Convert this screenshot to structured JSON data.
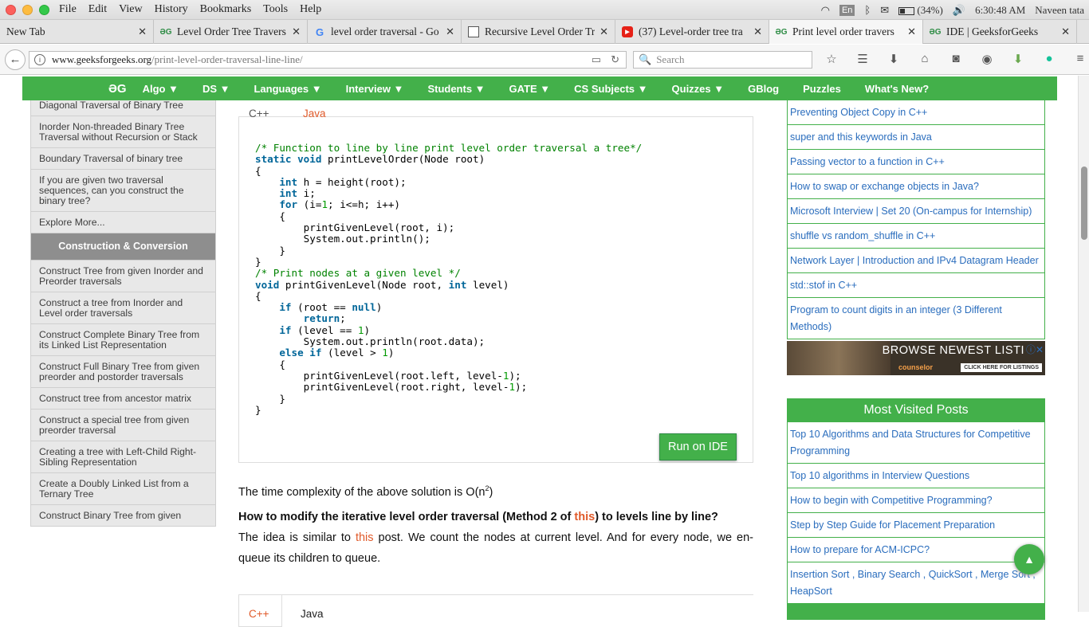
{
  "menubar": {
    "items": [
      "File",
      "Edit",
      "View",
      "History",
      "Bookmarks",
      "Tools",
      "Help"
    ],
    "battery": "(34%)",
    "lang": "En",
    "time": "6:30:48 AM",
    "user": "Naveen tata"
  },
  "tabs": [
    {
      "title": "New Tab",
      "icon": "none"
    },
    {
      "title": "Level Order Tree Travers",
      "icon": "gfg-icon"
    },
    {
      "title": "level order traversal - Go",
      "icon": "google-icon"
    },
    {
      "title": "Recursive Level Order Tr",
      "icon": "page-icon"
    },
    {
      "title": "(37) Level-order tree tra",
      "icon": "youtube-icon"
    },
    {
      "title": "Print level order travers",
      "icon": "gfg-icon",
      "active": true
    },
    {
      "title": "IDE | GeeksforGeeks",
      "icon": "gfg-icon"
    }
  ],
  "address": {
    "domain": "www.geeksforgeeks.org",
    "path": "/print-level-order-traversal-line-line/"
  },
  "search": {
    "placeholder": "Search"
  },
  "sitenav": {
    "logo": "ƏG",
    "items": [
      "Algo ▼",
      "DS ▼",
      "Languages ▼",
      "Interview ▼",
      "Students ▼",
      "GATE ▼",
      "CS Subjects ▼",
      "Quizzes ▼",
      "GBlog",
      "Puzzles",
      "What's New?"
    ]
  },
  "sidebar": [
    {
      "label": "Diagonal Traversal of Binary Tree"
    },
    {
      "label": "Inorder Non-threaded Binary Tree Traversal without Recursion or Stack"
    },
    {
      "label": "Boundary Traversal of binary tree"
    },
    {
      "label": "If you are given two traversal sequences, can you construct the binary tree?"
    },
    {
      "label": "Explore More..."
    },
    {
      "label": "Construction & Conversion",
      "header": true
    },
    {
      "label": "Construct Tree from given Inorder and Preorder traversals"
    },
    {
      "label": "Construct a tree from Inorder and Level order traversals"
    },
    {
      "label": "Construct Complete Binary Tree from its Linked List Representation"
    },
    {
      "label": "Construct Full Binary Tree from given preorder and postorder traversals"
    },
    {
      "label": "Construct tree from ancestor matrix"
    },
    {
      "label": "Construct a special tree from given preorder traversal"
    },
    {
      "label": "Creating a tree with Left-Child Right-Sibling Representation"
    },
    {
      "label": "Create a Doubly Linked List from a Ternary Tree"
    },
    {
      "label": "Construct Binary Tree from given"
    }
  ],
  "codetabs": {
    "cpp": "C++",
    "java": "Java"
  },
  "run_label": "Run on IDE",
  "complexity": {
    "text": "The time complexity of the above solution is O(n",
    "sup": "2",
    "close": ")"
  },
  "question": {
    "pre": "How to modify the iterative level order traversal (Method 2 of ",
    "link": "this",
    "post": ") to levels line by line?"
  },
  "idea": {
    "pre": "The idea is similar to ",
    "link": "this",
    "post": " post. We count the nodes at current level. And for every node, we en-queue its children to queue."
  },
  "right_links": [
    "Preventing Object Copy in C++",
    "super and this keywords in Java",
    "Passing vector to a function in C++",
    "How to swap or exchange objects in Java?",
    "Microsoft Interview | Set 20 (On-campus for Internship)",
    "shuffle vs random_shuffle in C++",
    "Network Layer | Introduction and IPv4 Datagram Header",
    "std::stof in C++",
    "Program to count digits in an integer (3 Different Methods)"
  ],
  "ad": {
    "text": "BROWSE NEWEST LISTI",
    "brand": "counselor",
    "cta": "CLICK HERE FOR LISTINGS"
  },
  "most_visited": {
    "title": "Most Visited Posts",
    "items": [
      "Top 10 Algorithms and Data Structures for Competitive Programming",
      "Top 10 algorithms in Interview Questions",
      "How to begin with Competitive Programming?",
      "Step by Step Guide for Placement Preparation",
      "How to prepare for ACM-ICPC?",
      "Insertion Sort , Binary Search , QuickSort , Merge Sort , HeapSort"
    ]
  }
}
